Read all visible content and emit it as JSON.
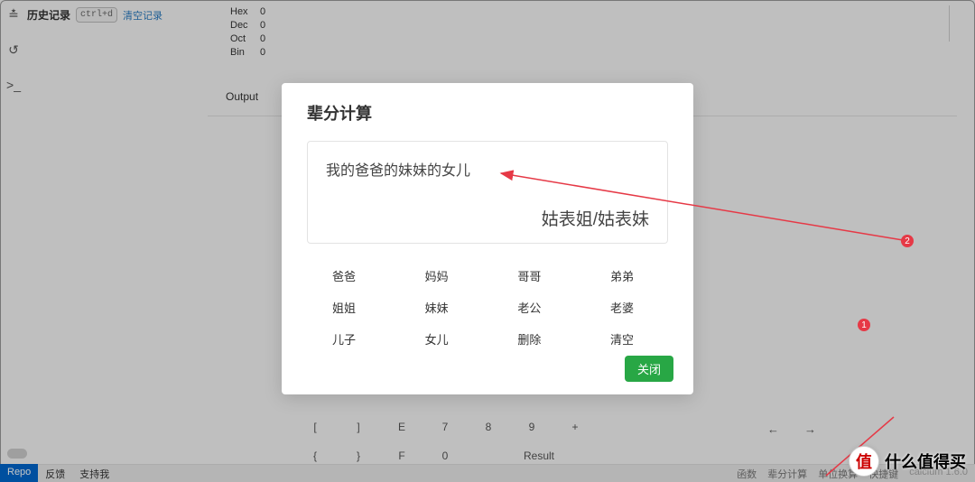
{
  "history": {
    "title": "历史记录",
    "shortcut": "ctrl+d",
    "clear": "清空记录"
  },
  "bases": {
    "hex": {
      "label": "Hex",
      "value": "0"
    },
    "dec": {
      "label": "Dec",
      "value": "0"
    },
    "oct": {
      "label": "Oct",
      "value": "0"
    },
    "bin": {
      "label": "Bin",
      "value": "0"
    }
  },
  "output_label": "Output",
  "keypad": {
    "row1": [
      "[",
      "]",
      "E",
      "7",
      "8",
      "9",
      "+"
    ],
    "row2": [
      "{",
      "}",
      "F",
      "0",
      "",
      "Result",
      ""
    ]
  },
  "arrow_keys": {
    "left": "←",
    "right": "→"
  },
  "modal": {
    "title": "辈分计算",
    "query": "我的爸爸的妹妹的女儿",
    "result": "姑表姐/姑表妹",
    "buttons": [
      [
        "爸爸",
        "妈妈",
        "哥哥",
        "弟弟"
      ],
      [
        "姐姐",
        "妹妹",
        "老公",
        "老婆"
      ],
      [
        "儿子",
        "女儿",
        "删除",
        "清空"
      ]
    ],
    "close": "关闭"
  },
  "bottombar": {
    "left": [
      "Repo",
      "反馈",
      "支持我"
    ],
    "right": [
      "函数",
      "辈分计算",
      "单位换算",
      "快捷键"
    ],
    "version": "calcium 1.6.0"
  },
  "annotations": {
    "badge1": "1",
    "badge2": "2"
  },
  "watermark": {
    "circle": "值",
    "text": "什么值得买"
  },
  "sidebar_icons": [
    "calc",
    "undo",
    "prompt"
  ],
  "colors": {
    "accent": "#28a745",
    "link": "#2a7abf",
    "brand_red": "#e63946"
  }
}
